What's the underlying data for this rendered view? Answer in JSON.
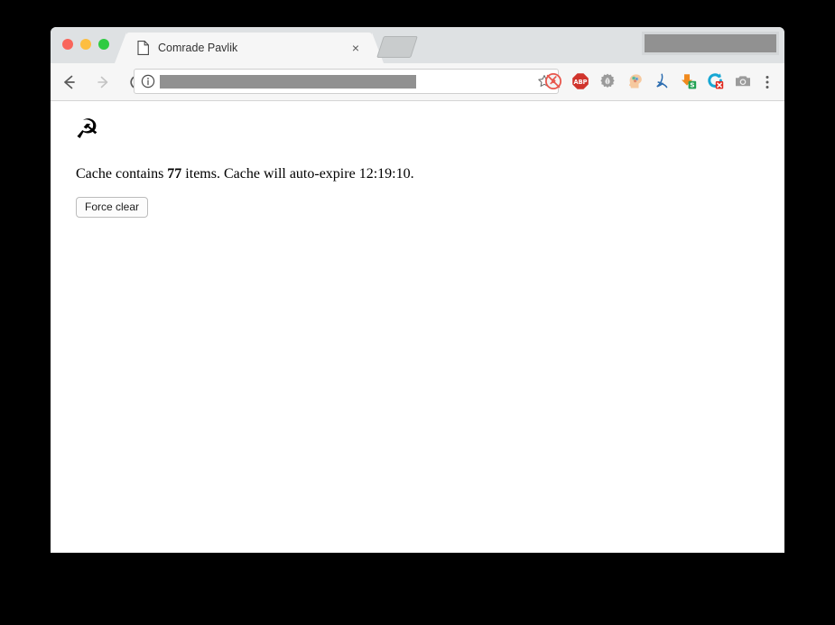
{
  "window": {
    "traffic_lights": [
      {
        "name": "close",
        "color": "#f9655b"
      },
      {
        "name": "minimize",
        "color": "#fdbe41"
      },
      {
        "name": "maximize",
        "color": "#2ecb42"
      }
    ]
  },
  "tab_strip": {
    "active_tab": {
      "title": "Comrade Pavlik",
      "favicon": "page-icon",
      "close_label": "×"
    },
    "new_tab_label": "",
    "redacted_region": true
  },
  "toolbar": {
    "back_icon": "arrow-left-icon",
    "forward_icon": "arrow-right-icon",
    "reload_icon": "reload-icon",
    "site_info_icon": "info-circle-icon",
    "bookmark_icon": "star-outline-icon",
    "menu_icon": "kebab-menu-icon",
    "address_value": "",
    "address_placeholder": "",
    "address_redacted": true,
    "extensions": [
      {
        "name": "plug-disabled-icon",
        "title": ""
      },
      {
        "name": "adblock-plus-icon",
        "title": "ABP"
      },
      {
        "name": "bug-gear-icon",
        "title": ""
      },
      {
        "name": "head-brain-icon",
        "title": ""
      },
      {
        "name": "adobe-acrobat-icon",
        "title": ""
      },
      {
        "name": "download-excel-icon",
        "title": ""
      },
      {
        "name": "refresh-block-icon",
        "title": ""
      },
      {
        "name": "camera-icon",
        "title": ""
      }
    ]
  },
  "page": {
    "logo_glyph": "☭",
    "logo_name": "hammer-and-sickle-icon",
    "status_prefix": "Cache contains ",
    "status_count": "77",
    "status_suffix": " items. Cache will auto-expire ",
    "status_time": "12:19:10",
    "status_end": ".",
    "force_clear_label": "Force clear"
  },
  "colors": {
    "tab_strip_bg": "#dee1e3",
    "toolbar_bg": "#f6f6f6",
    "active_tab_bg": "#f6f6f6",
    "redaction": "#919191",
    "page_bg": "#ffffff",
    "desktop_bg": "#000000"
  }
}
